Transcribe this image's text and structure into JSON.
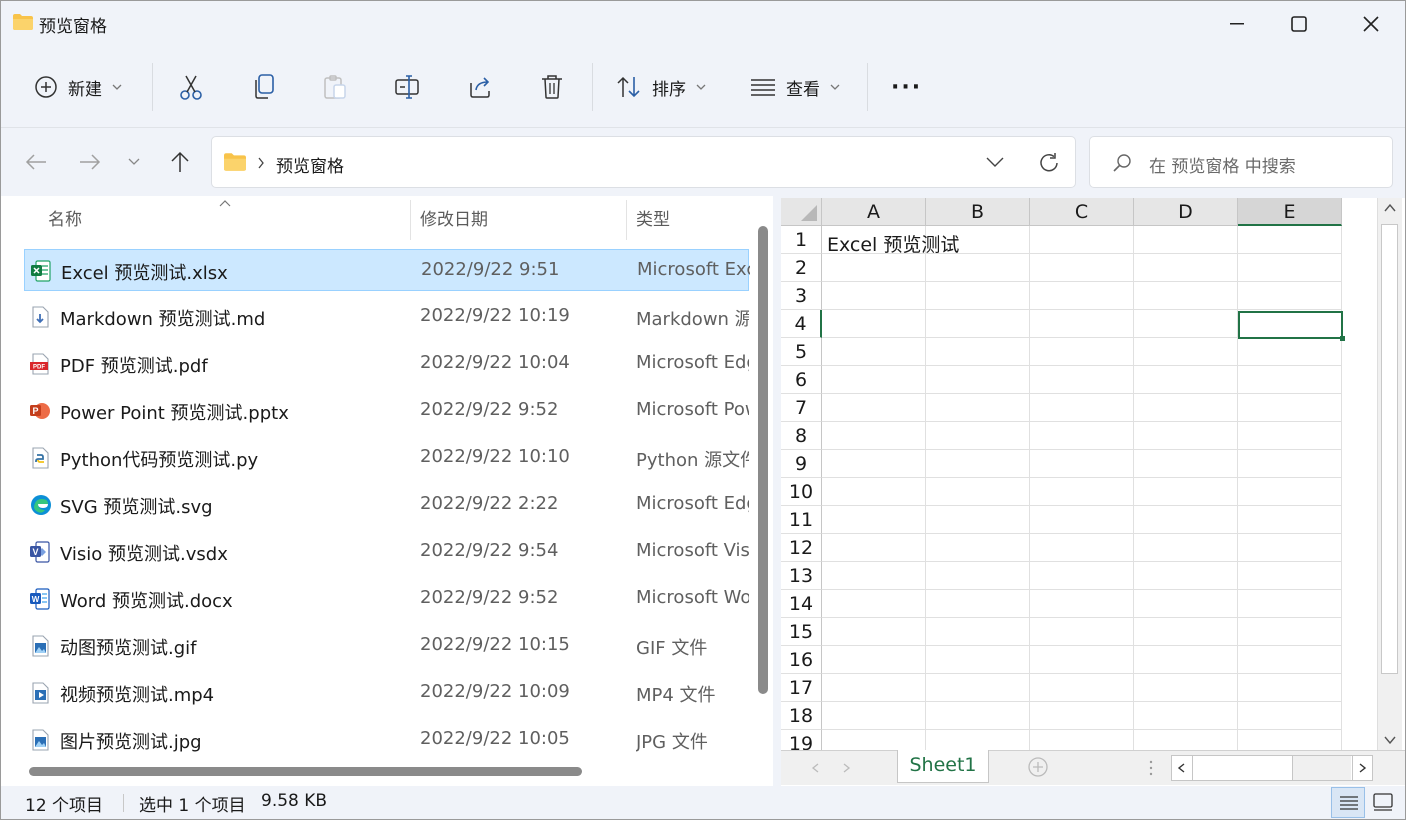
{
  "window": {
    "title": "预览窗格"
  },
  "toolbar": {
    "new_label": "新建",
    "sort_label": "排序",
    "view_label": "查看",
    "more_label": "···"
  },
  "address": {
    "path": "预览窗格"
  },
  "search": {
    "placeholder": "在 预览窗格 中搜索"
  },
  "columns": {
    "name": "名称",
    "date": "修改日期",
    "type": "类型"
  },
  "files": [
    {
      "name": "Excel 预览测试.xlsx",
      "date": "2022/9/22 9:51",
      "type": "Microsoft Excel",
      "icon": "excel-icon",
      "selected": true
    },
    {
      "name": "Markdown 预览测试.md",
      "date": "2022/9/22 10:19",
      "type": "Markdown 源文件",
      "icon": "markdown-icon",
      "selected": false
    },
    {
      "name": "PDF 预览测试.pdf",
      "date": "2022/9/22 10:04",
      "type": "Microsoft Edge",
      "icon": "pdf-icon",
      "selected": false
    },
    {
      "name": "Power Point 预览测试.pptx",
      "date": "2022/9/22 9:52",
      "type": "Microsoft PowerPoint",
      "icon": "powerpoint-icon",
      "selected": false
    },
    {
      "name": "Python代码预览测试.py",
      "date": "2022/9/22 10:10",
      "type": "Python 源文件",
      "icon": "python-icon",
      "selected": false
    },
    {
      "name": "SVG 预览测试.svg",
      "date": "2022/9/22 2:22",
      "type": "Microsoft Edge",
      "icon": "edge-icon",
      "selected": false
    },
    {
      "name": "Visio 预览测试.vsdx",
      "date": "2022/9/22 9:54",
      "type": "Microsoft Visio",
      "icon": "visio-icon",
      "selected": false
    },
    {
      "name": "Word 预览测试.docx",
      "date": "2022/9/22 9:52",
      "type": "Microsoft Word",
      "icon": "word-icon",
      "selected": false
    },
    {
      "name": "动图预览测试.gif",
      "date": "2022/9/22 10:15",
      "type": "GIF 文件",
      "icon": "image-icon",
      "selected": false
    },
    {
      "name": "视频预览测试.mp4",
      "date": "2022/9/22 10:09",
      "type": "MP4 文件",
      "icon": "video-icon",
      "selected": false
    },
    {
      "name": "图片预览测试.jpg",
      "date": "2022/9/22 10:05",
      "type": "JPG 文件",
      "icon": "image-icon",
      "selected": false
    }
  ],
  "preview": {
    "columns": [
      "A",
      "B",
      "C",
      "D",
      "E"
    ],
    "rows": [
      "1",
      "2",
      "3",
      "4",
      "5",
      "6",
      "7",
      "8",
      "9",
      "10",
      "11",
      "12",
      "13",
      "14",
      "15",
      "16",
      "17",
      "18",
      "19"
    ],
    "cell_a1": "Excel 预览测试",
    "active_column": "E",
    "active_row": "4",
    "sheet_tab": "Sheet1"
  },
  "status": {
    "count": "12 个项目",
    "selection": "选中 1 个项目",
    "size": "9.58 KB"
  },
  "colors": {
    "accent": "#217346",
    "selection": "#cce8ff",
    "folder": "#f8c34a"
  }
}
